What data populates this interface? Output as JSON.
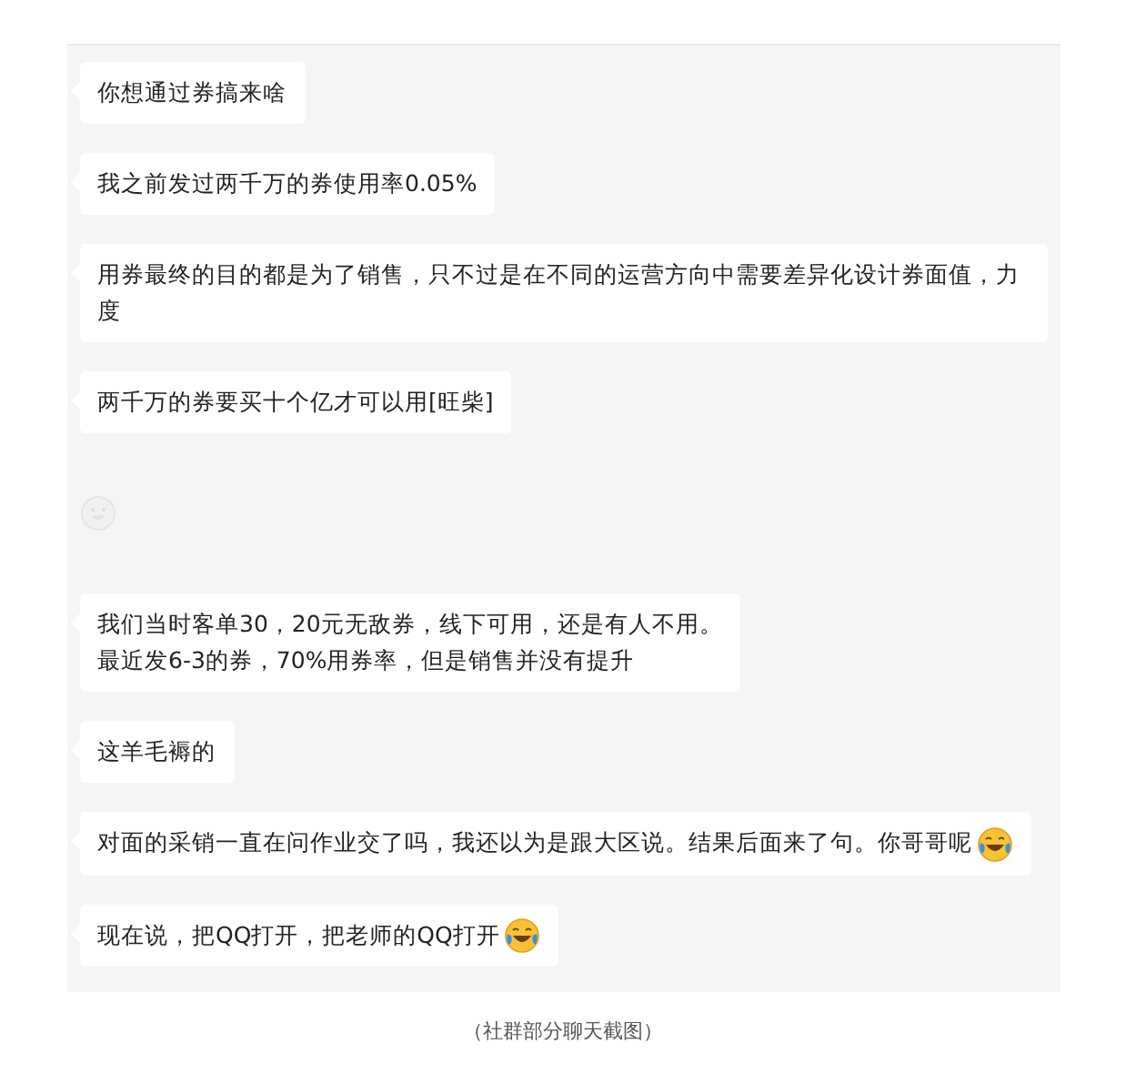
{
  "messages": [
    {
      "kind": "text",
      "lines": [
        "你想通过券搞来啥"
      ],
      "emoji_after": false
    },
    {
      "kind": "text",
      "lines": [
        "我之前发过两千万的券使用率0.05%"
      ],
      "emoji_after": false
    },
    {
      "kind": "text",
      "lines": [
        "用券最终的目的都是为了销售，只不过是在不同的运营方向中需要差异化设计券面值，力度"
      ],
      "emoji_after": false
    },
    {
      "kind": "text",
      "lines": [
        "两千万的券要买十个亿才可以用[旺柴]"
      ],
      "emoji_after": false
    },
    {
      "kind": "sticker"
    },
    {
      "kind": "text",
      "lines": [
        "我们当时客单30，20元无敌券，线下可用，还是有人不用。",
        "最近发6-3的券，70%用券率，但是销售并没有提升"
      ],
      "emoji_after": false
    },
    {
      "kind": "text",
      "lines": [
        "这羊毛褥的"
      ],
      "emoji_after": false
    },
    {
      "kind": "text",
      "lines": [
        "对面的采销一直在问作业交了吗，我还以为是跟大区说。结果后面来了句。你哥哥呢"
      ],
      "emoji_after": true
    },
    {
      "kind": "text",
      "lines": [
        "现在说，把QQ打开，把老师的QQ打开"
      ],
      "emoji_after": true
    }
  ],
  "caption": "（社群部分聊天截图）"
}
